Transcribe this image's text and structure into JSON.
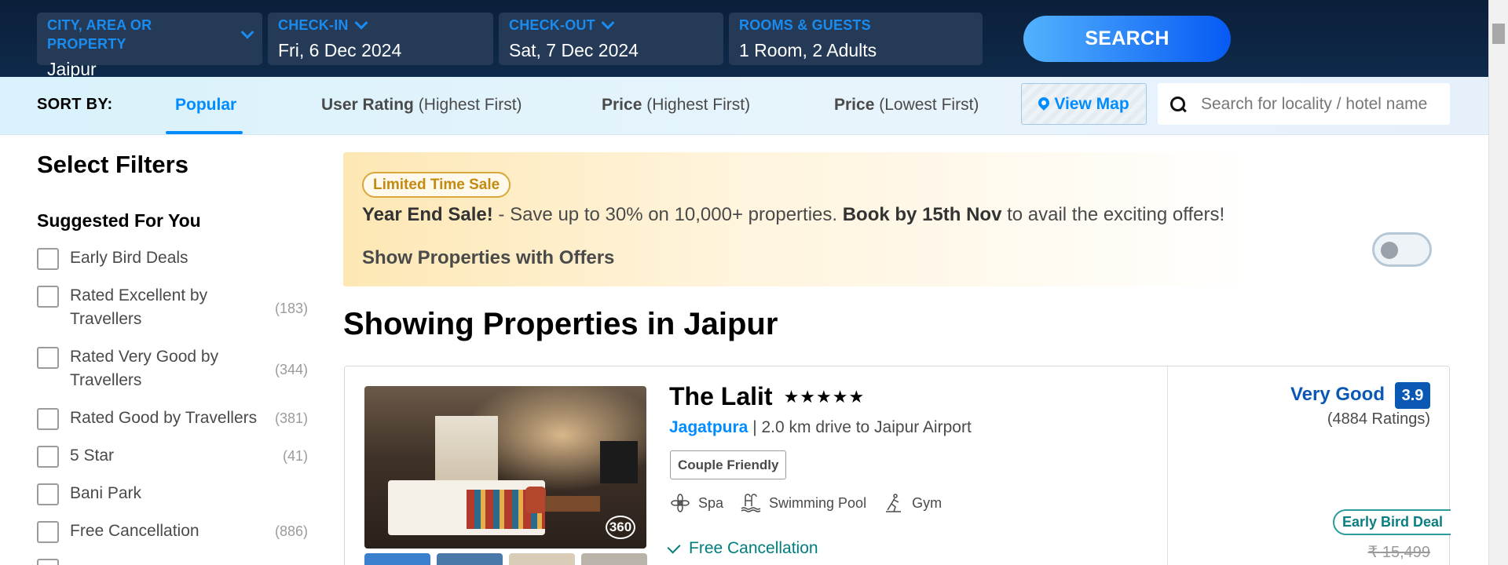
{
  "search": {
    "city": {
      "label": "CITY, AREA OR PROPERTY",
      "value": "Jaipur"
    },
    "checkin": {
      "label": "CHECK-IN",
      "value": "Fri, 6 Dec 2024"
    },
    "checkout": {
      "label": "CHECK-OUT",
      "value": "Sat, 7 Dec 2024"
    },
    "rooms": {
      "label": "ROOMS & GUESTS",
      "value": "1 Room, 2 Adults"
    },
    "button": "SEARCH"
  },
  "sort": {
    "label": "SORT BY:",
    "options": [
      {
        "main": "Popular",
        "sub": ""
      },
      {
        "main": "User Rating",
        "sub": "(Highest First)"
      },
      {
        "main": "Price",
        "sub": "(Highest First)"
      },
      {
        "main": "Price",
        "sub": "(Lowest First)"
      }
    ],
    "view_map": "View Map",
    "locality_placeholder": "Search for locality / hotel name"
  },
  "filters": {
    "title": "Select Filters",
    "section": "Suggested For You",
    "items": [
      {
        "label": "Early Bird Deals",
        "count": ""
      },
      {
        "label": "Rated Excellent by Travellers",
        "count": "(183)"
      },
      {
        "label": "Rated Very Good by Travellers",
        "count": "(344)"
      },
      {
        "label": "Rated Good by Travellers",
        "count": "(381)"
      },
      {
        "label": "5 Star",
        "count": "(41)"
      },
      {
        "label": "Bani Park",
        "count": ""
      },
      {
        "label": "Free Cancellation",
        "count": "(886)"
      }
    ]
  },
  "banner": {
    "tag": "Limited Time Sale",
    "headline_bold": "Year End Sale!",
    "headline_text": " - Save up to 30% on 10,000+ properties. ",
    "headline_bold2": "Book by 15th Nov",
    "headline_tail": " to avail the exciting offers!",
    "toggle_label": "Show Properties with Offers"
  },
  "results_title": "Showing Properties in Jaipur",
  "hotel": {
    "name": "The Lalit",
    "stars": "★★★★★",
    "area": "Jagatpura",
    "distance": " | 2.0 km drive to Jaipur Airport",
    "tag": "Couple Friendly",
    "amenities": [
      {
        "label": "Spa",
        "icon": "spa-icon"
      },
      {
        "label": "Swimming Pool",
        "icon": "pool-icon"
      },
      {
        "label": "Gym",
        "icon": "gym-icon"
      }
    ],
    "cancellation": "Free Cancellation",
    "rating_text": "Very Good",
    "rating_score": "3.9",
    "rating_count": "(4884 Ratings)",
    "deal": "Early Bird Deal",
    "old_price": "₹ 15,499",
    "badge_360": "360"
  },
  "colors": {
    "brand_blue": "#008cff",
    "header_bg": "#0b1f3a",
    "rating_blue": "#0b58b4",
    "teal": "#007e7d"
  }
}
